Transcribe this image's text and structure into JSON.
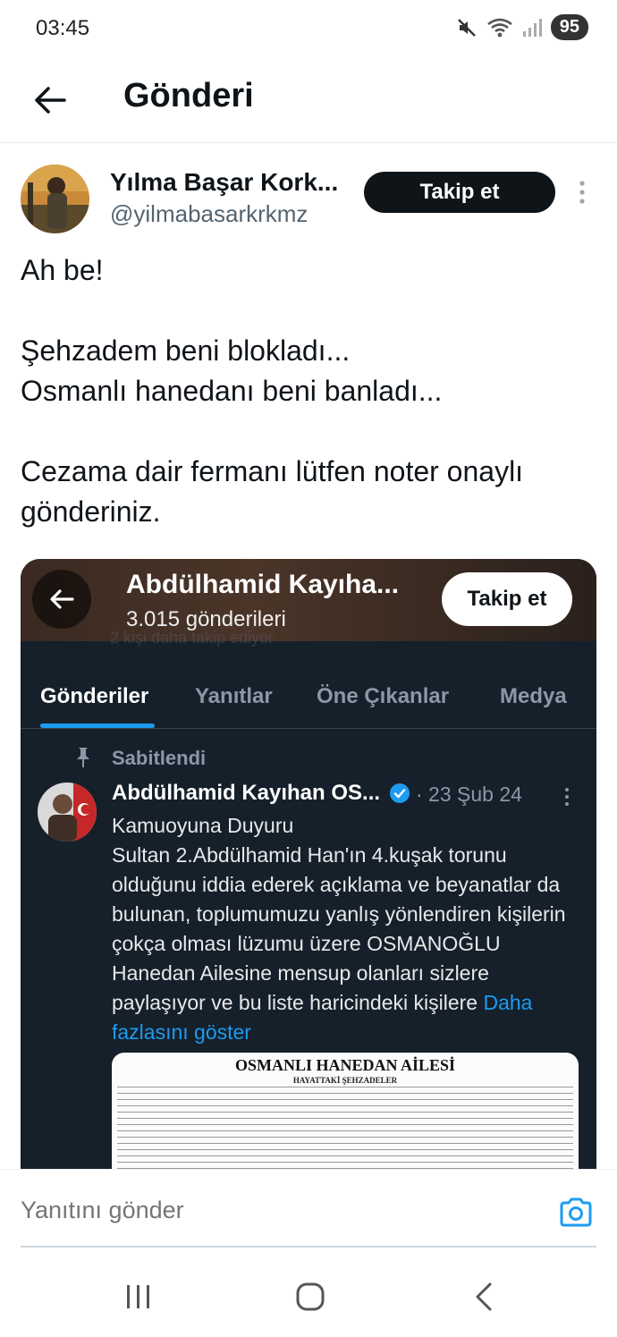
{
  "status_bar": {
    "time": "03:45",
    "battery": "95",
    "icons": [
      "mute-icon",
      "wifi-icon",
      "signal-icon"
    ]
  },
  "header": {
    "title": "Gönderi",
    "back_icon": "arrow-left-icon"
  },
  "post": {
    "author_name": "Yılma Başar Kork...",
    "author_handle": "@yilmabasarkrkmz",
    "follow_label": "Takip et",
    "text": "Ah be!\n\nŞehzadem beni blokladı...\nOsmanlı hanedanı beni banladı...\n\nCezama dair fermanı lütfen noter onaylı gönderiniz."
  },
  "embed": {
    "profile_name": "Abdülhamid Kayıha...",
    "post_count": "3.015 gönderileri",
    "follow_label": "Takip et",
    "faded_text": "2 kişi daha takip ediyor",
    "tabs": [
      "Gönderiler",
      "Yanıtlar",
      "Öne Çıkanlar",
      "Medya"
    ],
    "active_tab": "Gönderiler",
    "pinned_label": "Sabitlendi",
    "inner_post": {
      "author_name": "Abdülhamid Kayıhan OS...",
      "date": "· 23 Şub 24",
      "text": "Kamuoyuna Duyuru\nSultan 2.Abdülhamid Han'ın 4.kuşak torunu olduğunu iddia ederek açıklama ve beyanatlar da bulunan, toplumumuzu yanlış yönlendiren kişilerin çokça olması lüzumu üzere OSMANOĞLU Hanedan Ailesine mensup olanları sizlere paylaşıyor ve bu liste haricindeki kişilere ",
      "show_more": "Daha fazlasını göster"
    },
    "document": {
      "title": "OSMANLI HANEDAN AİLESİ",
      "subtitle": "HAYATTAKİ ŞEHZADELER"
    }
  },
  "reply": {
    "placeholder": "Yanıtını gönder"
  },
  "colors": {
    "accent": "#1d9bf0",
    "dark_bg": "#15202b",
    "text_primary": "#0f1419",
    "text_secondary": "#536471"
  }
}
